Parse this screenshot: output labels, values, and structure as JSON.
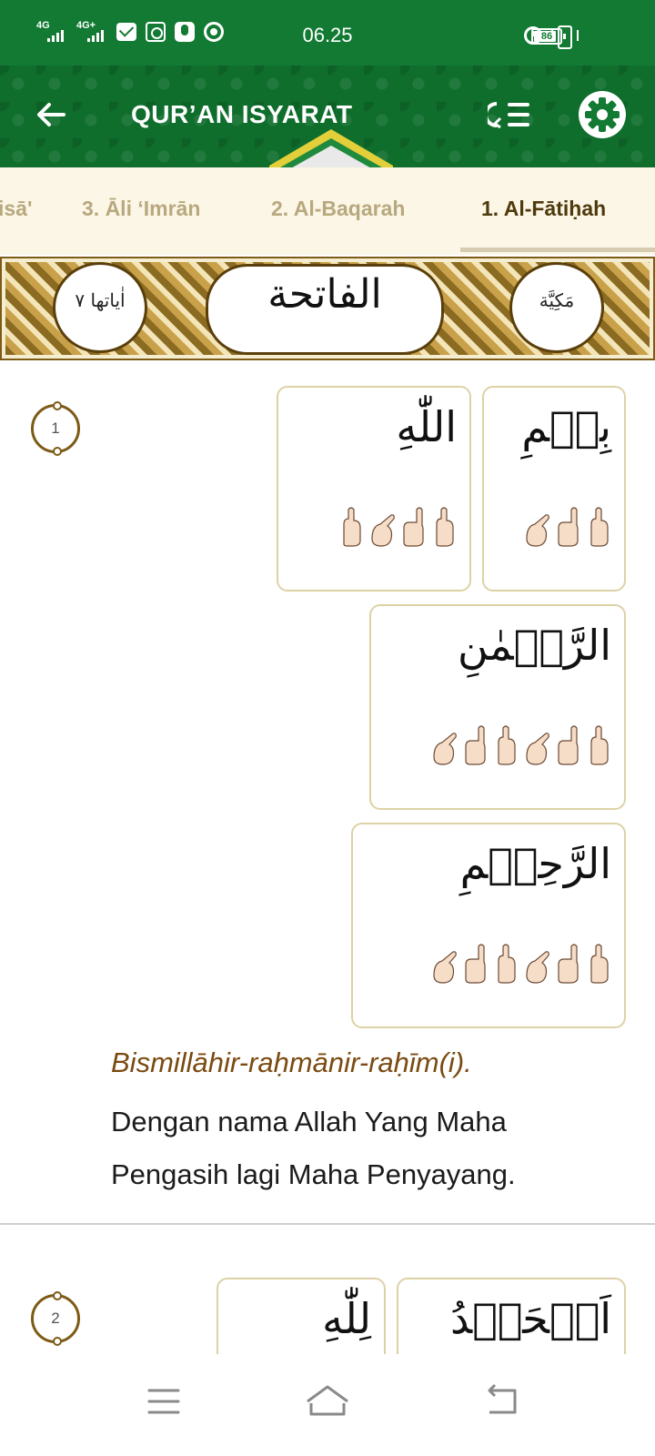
{
  "status_bar": {
    "net1": "4G",
    "net2": "4G+",
    "time": "06.25",
    "battery_level": "86",
    "battery_fraction": 0.86,
    "icons": [
      "signal-icon",
      "signal-icon",
      "mail-icon",
      "instagram-icon",
      "podcast-icon",
      "chrome-icon",
      "alarm-icon",
      "vibrate-icon",
      "battery-icon"
    ]
  },
  "app_bar": {
    "title": "QUR’AN ISYARAT",
    "back_icon": "arrow-left-icon",
    "list_icon": "list-icon",
    "settings_icon": "gear-icon",
    "color": "#127a33"
  },
  "tabs": [
    {
      "label": "isā'",
      "active": false
    },
    {
      "label": "3. Āli ‘Imrān",
      "active": false
    },
    {
      "label": "2. Al-Baqarah",
      "active": false
    },
    {
      "label": "1. Al-Fātiḥah",
      "active": true
    }
  ],
  "surah_header": {
    "name": "الفاتحة",
    "ayat": "اٰياتها ٧",
    "revelation": "مَكِيَّة"
  },
  "verses": [
    {
      "number": "1",
      "words": [
        {
          "arabic": "بِسۡمِ",
          "signs": 3
        },
        {
          "arabic": "اللّٰهِ",
          "signs": 4
        },
        {
          "arabic": "الرَّحۡمٰنِ",
          "signs": 6
        },
        {
          "arabic": "الرَّحِيۡمِ",
          "signs": 6
        }
      ],
      "transliteration": "Bismillāhir-raḥmānir-raḥīm(i).",
      "translation": "Dengan nama Allah Yang Maha Pengasih lagi Maha Penyayang."
    },
    {
      "number": "2",
      "words": [
        {
          "arabic": "اَلۡحَمۡدُ"
        },
        {
          "arabic": "لِلّٰهِ"
        }
      ]
    }
  ],
  "colors": {
    "primary_green": "#127a33",
    "gold": "#7d5a16",
    "tab_background": "#fbf6e6",
    "transliteration": "#7a4a10"
  },
  "nav_bar": {
    "icons": [
      "menu-icon",
      "home-icon",
      "back-icon"
    ]
  }
}
